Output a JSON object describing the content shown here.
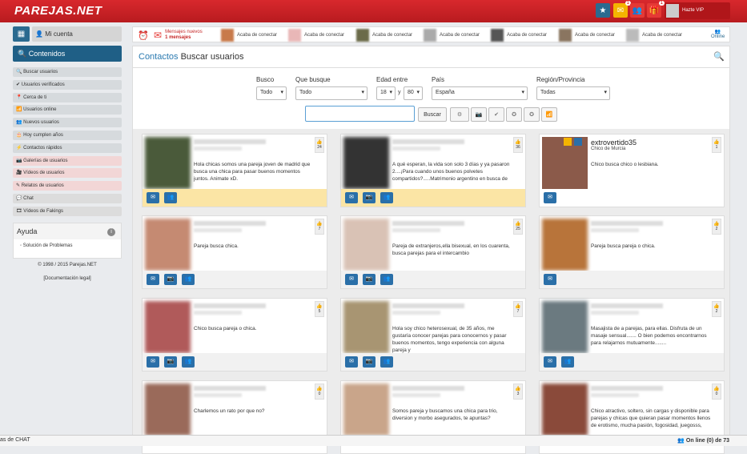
{
  "brand": {
    "logo": "PAREJAS.NET"
  },
  "topbar": {
    "vip_label": "Hazte VIP",
    "badges": [
      "1",
      "2",
      "1"
    ]
  },
  "notif": {
    "msg_line1": "Mensajes nuevos",
    "msg_line2": "1 mensajes",
    "connect": "Acaba de conectar",
    "online": "Online"
  },
  "sidebar": {
    "account": "Mi cuenta",
    "contents": "Contenidos",
    "items": [
      "Buscar usuarios",
      "Usuarios verificados",
      "Cerca de ti",
      "Usuarios online",
      "Nuevos usuarios",
      "Hoy cumplen años",
      "Contactos rápidos",
      "Galerías de usuarios",
      "Vídeos de usuarios",
      "Relatos de usuarios",
      "Chat",
      "Vídeos de Fakings"
    ],
    "help_title": "Ayuda",
    "help_item": "Solución de Problemas",
    "copyright": "© 1998 / 2015 Parejas.NET",
    "legal": "[Documentación legal]"
  },
  "main": {
    "crumb": "Contactos",
    "title": "Buscar usuarios"
  },
  "filters": {
    "busco_label": "Busco",
    "busco_value": "Todo",
    "que_label": "Que busque",
    "que_value": "Todo",
    "edad_label": "Edad entre",
    "edad_min": "18",
    "edad_y": "y",
    "edad_max": "80",
    "pais_label": "País",
    "pais_value": "España",
    "region_label": "Región/Provincia",
    "region_value": "Todas",
    "search_button": "Buscar"
  },
  "cards": [
    {
      "text": "Hola chicas somos una pareja joven de madrid que busca una chica para pasar buenos momentos juntos. Animate xD.",
      "likes": "24",
      "vip": true
    },
    {
      "text": "A qué esperan, la vida son solo 3 días y ya pasaron 2....¡Para cuando unos buenos polvetes compartidos?.....Matrimonio argentino en busca de",
      "likes": "36",
      "vip": true
    },
    {
      "title": "extrovertido35",
      "sub": "Chico de Murcia",
      "text": "Chico busca chico o lesbiana.",
      "likes": "1",
      "vip": false
    },
    {
      "text": "Pareja busca chica.",
      "likes": "7"
    },
    {
      "text": "Pareja de extranjeros,ella bisexual, en los cuarenta, busca parejas para el intercambio",
      "likes": "25"
    },
    {
      "text": "Pareja busca pareja o chica.",
      "likes": "2"
    },
    {
      "text": "Chico busca pareja o chica.",
      "likes": "5"
    },
    {
      "text": "Hola soy chico heterosexual, de 35 años, me gustaría conocer parejas para conocernos y pasar buenos momentos, tengo experiencia con alguna pareja y",
      "likes": "7"
    },
    {
      "text": "Masajista de a parejas, para ellas. Disfruta de un masaje sensual....... O bien podemos encontrarnos para relajarnos mutuamente........",
      "likes": "2"
    },
    {
      "text": "Charlemos un rato por que no?",
      "likes": "0"
    },
    {
      "text": "Somos pareja y buscamos una chica para trio, diversion y morbo asegurados, te apuntas?",
      "likes": "3"
    },
    {
      "text": "Chico atractivo, soltero, sin cargas y disponible para parejas y chicas que quieran pasar momentos llenos de erotismo, mucha pasión, fogosidad, juegosss,",
      "likes": "0"
    }
  ],
  "chat": {
    "left": "as de CHAT",
    "right": "On line (0) de 73"
  }
}
